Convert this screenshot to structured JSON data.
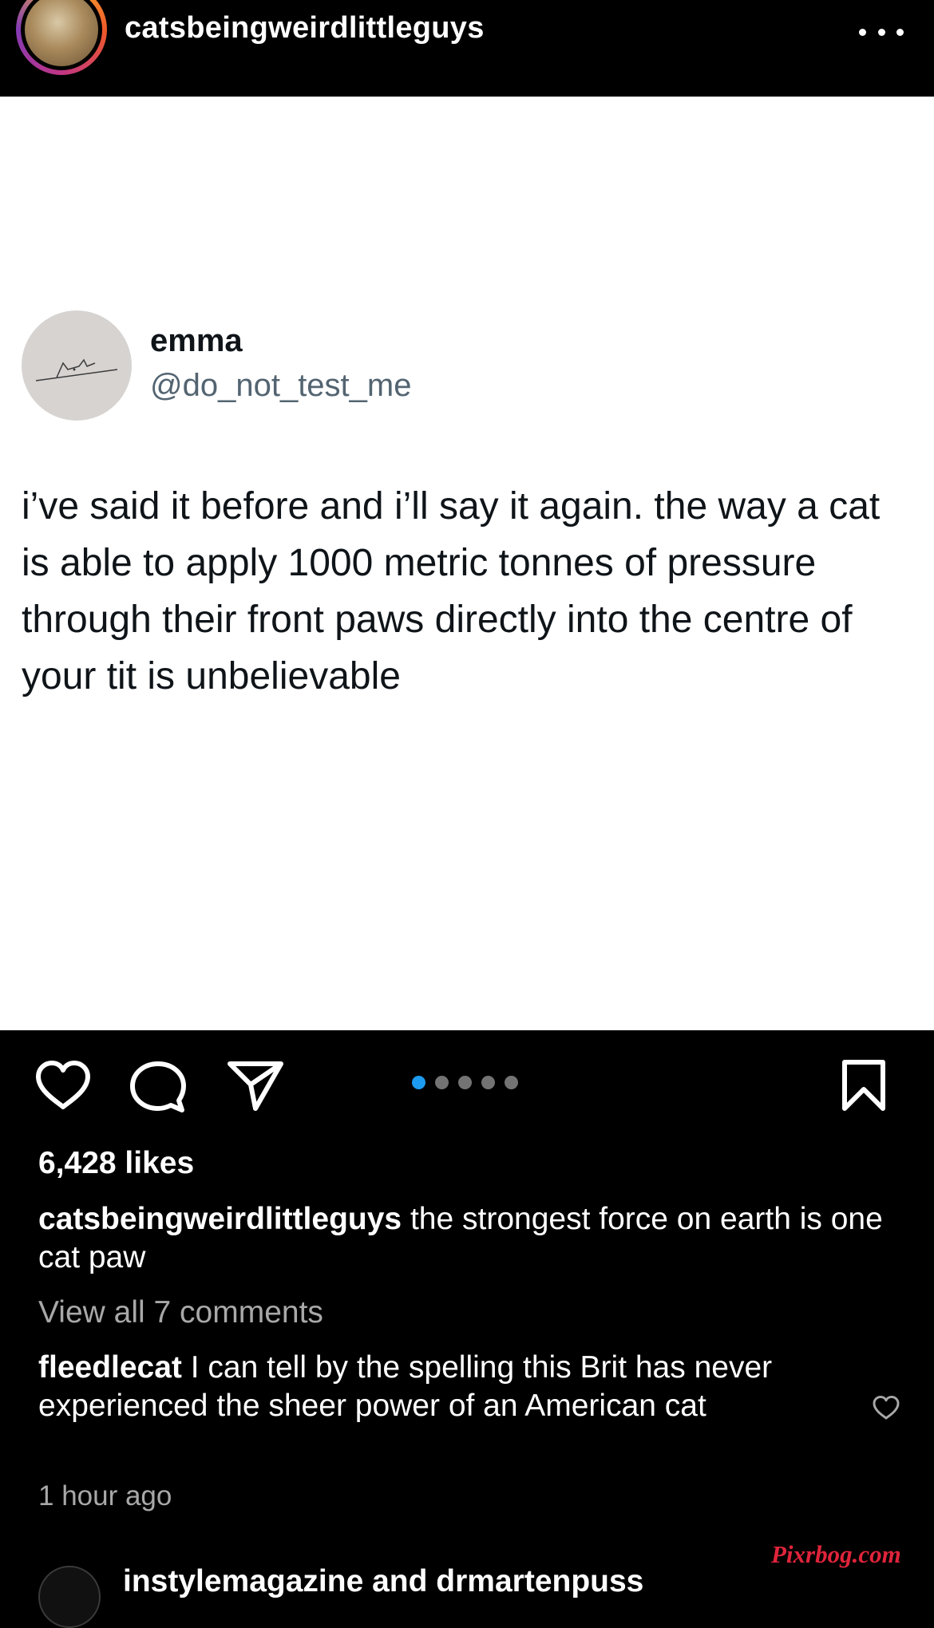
{
  "header": {
    "username": "catsbeingweirdlittleguys",
    "avatar_icon": "story-avatar",
    "more_icon": "ellipsis-icon"
  },
  "tweet": {
    "name": "emma",
    "handle": "@do_not_test_me",
    "text": "i’ve said it before and i’ll say it again. the way a cat is able to apply 1000 metric tonnes of pressure through their front paws directly into the centre of your tit is unbelievable"
  },
  "actions": {
    "like_icon": "heart-icon",
    "comment_icon": "comment-icon",
    "share_icon": "send-icon",
    "save_icon": "bookmark-icon",
    "carousel": {
      "total": 5,
      "active": 1
    }
  },
  "likes": "6,428 likes",
  "caption": {
    "username": "catsbeingweirdlittleguys",
    "text": " the strongest force on earth is one cat paw"
  },
  "view_all": "View all 7 comments",
  "comment": {
    "username": "fleedlecat",
    "text": " I can tell by the spelling this Brit has never experienced the sheer power of an American cat",
    "time": "1 hour ago"
  },
  "next_comment": {
    "text": "instylemagazine and drmartenpuss"
  },
  "watermark": "Pixrbog.com",
  "colors": {
    "background": "#000000",
    "accent_blue": "#1d9bf0",
    "muted_text": "#a8a8a8",
    "tweet_handle": "#536471"
  }
}
